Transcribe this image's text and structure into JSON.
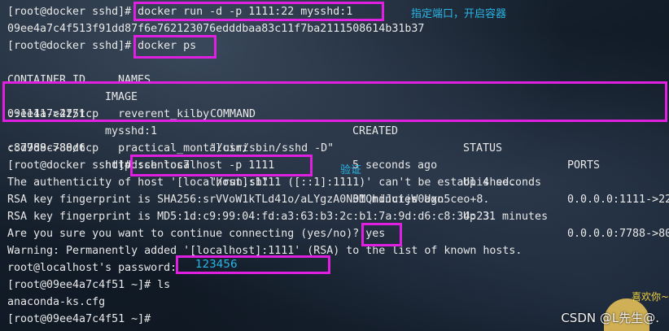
{
  "terminal": {
    "lines": [
      "[root@docker sshd]# docker run -d -p 1111:22 mysshd:1",
      "09ee4a7c4f513f91dd87f6e762123076edddbaa83c11f7ba2111508614b31b37",
      "[root@docker sshd]# docker ps",
      "",
      "",
      "",
      "::1111->22/tcp   reverent_kilby",
      "",
      "::7788->80/tcp   practical_montalcini",
      "[root@docker sshd]# ssh localhost -p 1111",
      "The authenticity of host '[localhost]:1111 ([::1]:1111)' can't be established.",
      "RSA key fingerprint is SHA256:srVVoW1kTLd41o/aLYgzA0N0MQhdJcijW0Uxn5ceo+8.",
      "RSA key fingerprint is MD5:1d:c9:99:04:fd:a3:63:b3:2c:b1:7a:9d:d6:c8:34:23.",
      "Are you sure you want to continue connecting (yes/no)? yes",
      "Warning: Permanently added '[localhost]:1111' (RSA) to the list of known hosts.",
      "root@localhost's password:",
      "[root@09ee4a7c4f51 ~]# ls",
      "anaconda-ks.cfg",
      "[root@09ee4a7c4f51 ~]#"
    ],
    "ps_header": [
      "CONTAINER ID",
      "IMAGE",
      "COMMAND",
      "CREATED",
      "STATUS",
      "PORTS"
    ],
    "ps_header_wrap": "NAMES",
    "ps_rows": [
      [
        "09ee4a7c4f51",
        "mysshd:1",
        "\"/usr/sbin/sshd -D\"",
        "5 seconds ago",
        "Up 4 seconds",
        "0.0.0.0:1111->22"
      ],
      [
        "c8d9d9c788d6",
        "httpd:centos7",
        "\"/run.sh\"",
        "31 minutes ago",
        "Up 31 minutes",
        "0.0.0.0:7788->80"
      ]
    ]
  },
  "annotations": {
    "note_run": "指定端口，开启容器",
    "note_verify": "验证",
    "typed_password": "123456"
  },
  "watermark": "CSDN @L先生@.",
  "deco_text": "喜欢你~",
  "colors": {
    "highlight": "#e020e0",
    "annotation": "#29b6e8"
  }
}
